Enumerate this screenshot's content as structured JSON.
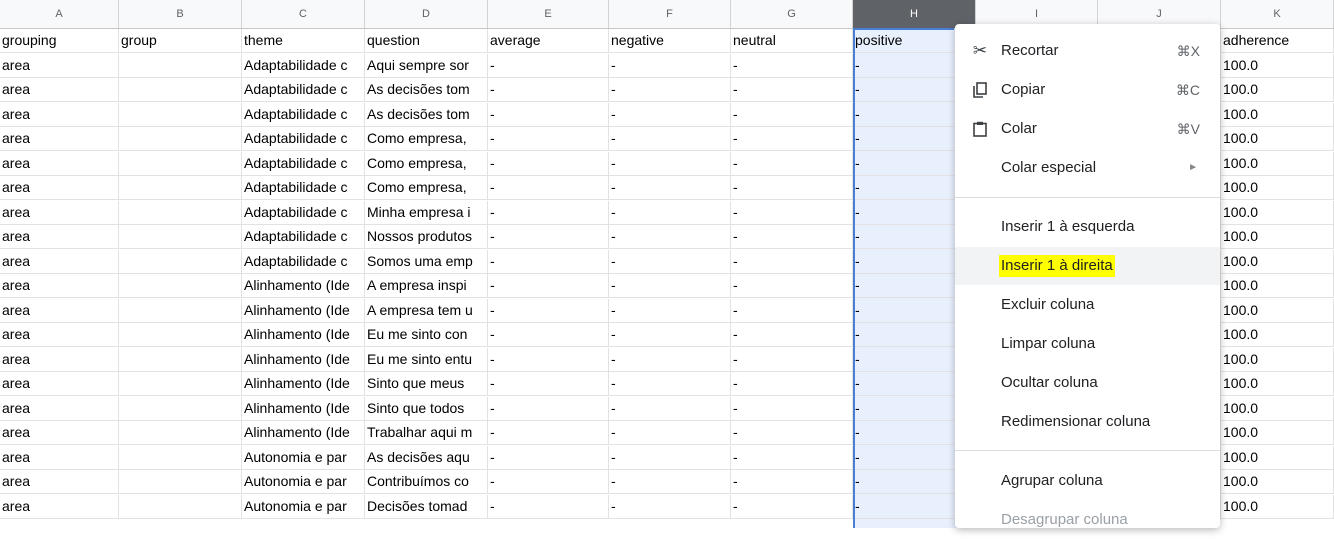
{
  "columns": [
    "A",
    "B",
    "C",
    "D",
    "E",
    "F",
    "G",
    "H",
    "I",
    "J",
    "K"
  ],
  "selected_column": "H",
  "header_row": [
    "grouping",
    "group",
    "theme",
    "question",
    "average",
    "negative",
    "neutral",
    "positive",
    "",
    "",
    "adherence"
  ],
  "rows": [
    [
      "area",
      "",
      "Adaptabilidade c",
      "Aqui sempre sor",
      "-",
      "-",
      "-",
      "-",
      "",
      "",
      "100.0"
    ],
    [
      "area",
      "",
      "Adaptabilidade c",
      "As decisões tom",
      "-",
      "-",
      "-",
      "-",
      "",
      "",
      "100.0"
    ],
    [
      "area",
      "",
      "Adaptabilidade c",
      "As decisões tom",
      "-",
      "-",
      "-",
      "-",
      "",
      "",
      "100.0"
    ],
    [
      "area",
      "",
      "Adaptabilidade c",
      "Como empresa,",
      "-",
      "-",
      "-",
      "-",
      "",
      "",
      "100.0"
    ],
    [
      "area",
      "",
      "Adaptabilidade c",
      "Como empresa,",
      "-",
      "-",
      "-",
      "-",
      "",
      "",
      "100.0"
    ],
    [
      "area",
      "",
      "Adaptabilidade c",
      "Como empresa,",
      "-",
      "-",
      "-",
      "-",
      "",
      "",
      "100.0"
    ],
    [
      "area",
      "",
      "Adaptabilidade c",
      "Minha empresa i",
      "-",
      "-",
      "-",
      "-",
      "",
      "",
      "100.0"
    ],
    [
      "area",
      "",
      "Adaptabilidade c",
      "Nossos produtos",
      "-",
      "-",
      "-",
      "-",
      "",
      "",
      "100.0"
    ],
    [
      "area",
      "",
      "Adaptabilidade c",
      "Somos uma emp",
      "-",
      "-",
      "-",
      "-",
      "",
      "",
      "100.0"
    ],
    [
      "area",
      "",
      "Alinhamento (Ide",
      "A empresa inspi",
      "-",
      "-",
      "-",
      "-",
      "",
      "",
      "100.0"
    ],
    [
      "area",
      "",
      "Alinhamento (Ide",
      "A empresa tem u",
      "-",
      "-",
      "-",
      "-",
      "",
      "",
      "100.0"
    ],
    [
      "area",
      "",
      "Alinhamento (Ide",
      "Eu me sinto con",
      "-",
      "-",
      "-",
      "-",
      "",
      "",
      "100.0"
    ],
    [
      "area",
      "",
      "Alinhamento (Ide",
      "Eu me sinto entu",
      "-",
      "-",
      "-",
      "-",
      "",
      "",
      "100.0"
    ],
    [
      "area",
      "",
      "Alinhamento (Ide",
      "Sinto que meus",
      "-",
      "-",
      "-",
      "-",
      "",
      "",
      "100.0"
    ],
    [
      "area",
      "",
      "Alinhamento (Ide",
      "Sinto que todos",
      "-",
      "-",
      "-",
      "-",
      "",
      "",
      "100.0"
    ],
    [
      "area",
      "",
      "Alinhamento (Ide",
      "Trabalhar aqui m",
      "-",
      "-",
      "-",
      "-",
      "",
      "",
      "100.0"
    ],
    [
      "area",
      "",
      "Autonomia e par",
      "As decisões aqu",
      "-",
      "-",
      "-",
      "-",
      "",
      "",
      "100.0"
    ],
    [
      "area",
      "",
      "Autonomia e par",
      "Contribuímos co",
      "-",
      "-",
      "-",
      "-",
      "",
      "",
      "100.0"
    ],
    [
      "area",
      "",
      "Autonomia e par",
      "Decisões tomad",
      "-",
      "-",
      "-",
      "-",
      "",
      "",
      "100.0"
    ]
  ],
  "context_menu": {
    "items": [
      {
        "label": "Recortar",
        "shortcut": "⌘X",
        "icon": "scissors-icon"
      },
      {
        "label": "Copiar",
        "shortcut": "⌘C",
        "icon": "copy-icon"
      },
      {
        "label": "Colar",
        "shortcut": "⌘V",
        "icon": "clipboard-icon"
      },
      {
        "label": "Colar especial",
        "shortcut": "",
        "icon": ""
      },
      {
        "label": "Inserir 1 à esquerda",
        "shortcut": "",
        "icon": ""
      },
      {
        "label": "Inserir 1 à direita",
        "shortcut": "",
        "icon": ""
      },
      {
        "label": "Excluir coluna",
        "shortcut": "",
        "icon": ""
      },
      {
        "label": "Limpar coluna",
        "shortcut": "",
        "icon": ""
      },
      {
        "label": "Ocultar coluna",
        "shortcut": "",
        "icon": ""
      },
      {
        "label": "Redimensionar coluna",
        "shortcut": "",
        "icon": ""
      },
      {
        "label": "Agrupar coluna",
        "shortcut": "",
        "icon": ""
      },
      {
        "label": "Desagrupar coluna",
        "shortcut": "",
        "icon": ""
      }
    ],
    "highlighted_item": "Inserir 1 à direita",
    "highlight_color": "#ffff00"
  }
}
